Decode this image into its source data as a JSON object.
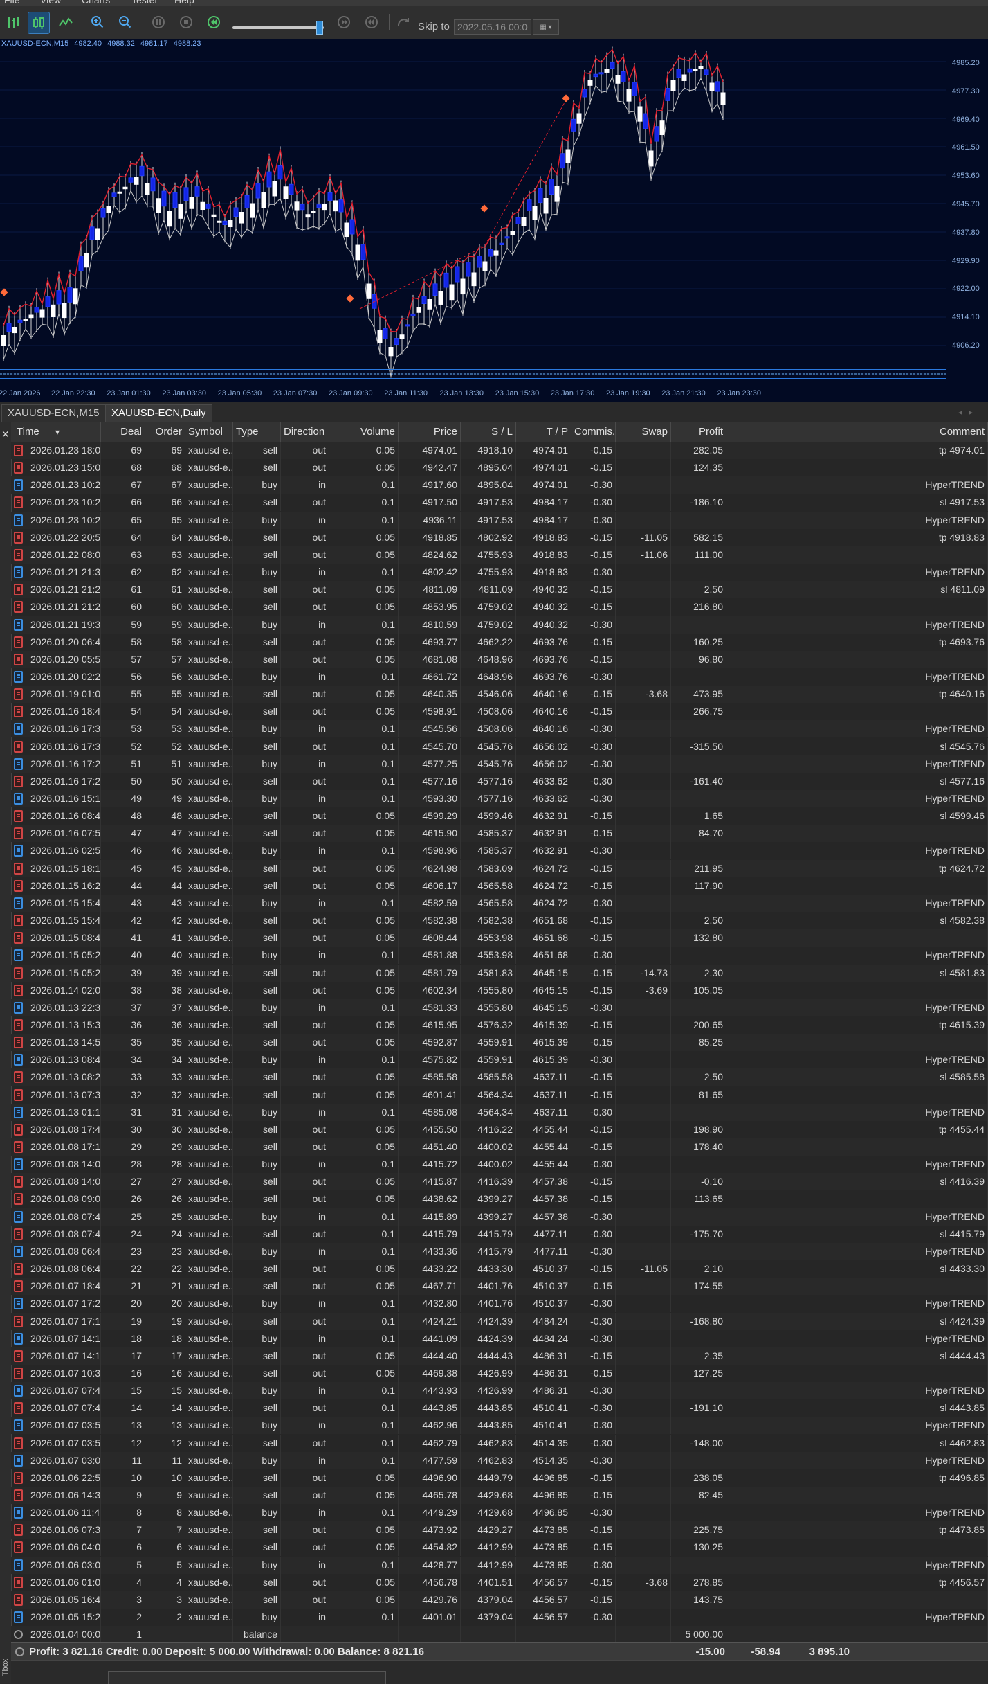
{
  "menu": [
    "File",
    "View",
    "Charts",
    "Tester",
    "Help"
  ],
  "toolbar": {
    "skip_label": "Skip to",
    "skip_value": "2022.05.16 00:00",
    "speed_fraction": 0.95
  },
  "chart": {
    "symbol_info": "XAUUSD-ECN,M15",
    "ohlc": [
      "4982.40",
      "4988.32",
      "4981.17",
      "4988.23"
    ],
    "price_ticks": [
      "4985.20",
      "4977.30",
      "4969.40",
      "4961.50",
      "4953.60",
      "4945.70",
      "4937.80",
      "4929.90",
      "4922.00",
      "4914.10",
      "4906.20"
    ],
    "time_ticks": [
      "22 Jan 2026",
      "22 Jan 22:30",
      "23 Jan 01:30",
      "23 Jan 03:30",
      "23 Jan 05:30",
      "23 Jan 07:30",
      "23 Jan 09:30",
      "23 Jan 11:30",
      "23 Jan 13:30",
      "23 Jan 15:30",
      "23 Jan 17:30",
      "23 Jan 19:30",
      "23 Jan 21:30",
      "23 Jan 23:30"
    ]
  },
  "chart_tabs": [
    "XAUUSD-ECN,M15",
    "XAUUSD-ECN,Daily"
  ],
  "table": {
    "columns": [
      "Time",
      "Deal",
      "Order",
      "Symbol",
      "Type",
      "Direction",
      "Volume",
      "Price",
      "S / L",
      "T / P",
      "Commis...",
      "Swap",
      "Profit",
      "Comment"
    ],
    "rows": [
      [
        "2026.01.23 18:0...",
        "69",
        "69",
        "xauusd-e...",
        "sell",
        "out",
        "0.05",
        "4974.01",
        "4918.10",
        "4974.01",
        "-0.15",
        "",
        "282.05",
        "tp 4974.01"
      ],
      [
        "2026.01.23 15:0...",
        "68",
        "68",
        "xauusd-e...",
        "sell",
        "out",
        "0.05",
        "4942.47",
        "4895.04",
        "4974.01",
        "-0.15",
        "",
        "124.35",
        ""
      ],
      [
        "2026.01.23 10:2...",
        "67",
        "67",
        "xauusd-e...",
        "buy",
        "in",
        "0.1",
        "4917.60",
        "4895.04",
        "4974.01",
        "-0.30",
        "",
        "",
        "HyperTREND"
      ],
      [
        "2026.01.23 10:2...",
        "66",
        "66",
        "xauusd-e...",
        "sell",
        "out",
        "0.1",
        "4917.50",
        "4917.53",
        "4984.17",
        "-0.30",
        "",
        "-186.10",
        "sl 4917.53"
      ],
      [
        "2026.01.23 10:2...",
        "65",
        "65",
        "xauusd-e...",
        "buy",
        "in",
        "0.1",
        "4936.11",
        "4917.53",
        "4984.17",
        "-0.30",
        "",
        "",
        "HyperTREND"
      ],
      [
        "2026.01.22 20:5...",
        "64",
        "64",
        "xauusd-e...",
        "sell",
        "out",
        "0.05",
        "4918.85",
        "4802.92",
        "4918.83",
        "-0.15",
        "-11.05",
        "582.15",
        "tp 4918.83"
      ],
      [
        "2026.01.22 08:0...",
        "63",
        "63",
        "xauusd-e...",
        "sell",
        "out",
        "0.05",
        "4824.62",
        "4755.93",
        "4918.83",
        "-0.15",
        "-11.06",
        "111.00",
        ""
      ],
      [
        "2026.01.21 21:3...",
        "62",
        "62",
        "xauusd-e...",
        "buy",
        "in",
        "0.1",
        "4802.42",
        "4755.93",
        "4918.83",
        "-0.30",
        "",
        "",
        "HyperTREND"
      ],
      [
        "2026.01.21 21:2...",
        "61",
        "61",
        "xauusd-e...",
        "sell",
        "out",
        "0.05",
        "4811.09",
        "4811.09",
        "4940.32",
        "-0.15",
        "",
        "2.50",
        "sl 4811.09"
      ],
      [
        "2026.01.21 21:2...",
        "60",
        "60",
        "xauusd-e...",
        "sell",
        "out",
        "0.05",
        "4853.95",
        "4759.02",
        "4940.32",
        "-0.15",
        "",
        "216.80",
        ""
      ],
      [
        "2026.01.21 19:3...",
        "59",
        "59",
        "xauusd-e...",
        "buy",
        "in",
        "0.1",
        "4810.59",
        "4759.02",
        "4940.32",
        "-0.30",
        "",
        "",
        "HyperTREND"
      ],
      [
        "2026.01.20 06:4...",
        "58",
        "58",
        "xauusd-e...",
        "sell",
        "out",
        "0.05",
        "4693.77",
        "4662.22",
        "4693.76",
        "-0.15",
        "",
        "160.25",
        "tp 4693.76"
      ],
      [
        "2026.01.20 05:5...",
        "57",
        "57",
        "xauusd-e...",
        "sell",
        "out",
        "0.05",
        "4681.08",
        "4648.96",
        "4693.76",
        "-0.15",
        "",
        "96.80",
        ""
      ],
      [
        "2026.01.20 02:2...",
        "56",
        "56",
        "xauusd-e...",
        "buy",
        "in",
        "0.1",
        "4661.72",
        "4648.96",
        "4693.76",
        "-0.30",
        "",
        "",
        "HyperTREND"
      ],
      [
        "2026.01.19 01:0...",
        "55",
        "55",
        "xauusd-e...",
        "sell",
        "out",
        "0.05",
        "4640.35",
        "4546.06",
        "4640.16",
        "-0.15",
        "-3.68",
        "473.95",
        "tp 4640.16"
      ],
      [
        "2026.01.16 18:4...",
        "54",
        "54",
        "xauusd-e...",
        "sell",
        "out",
        "0.05",
        "4598.91",
        "4508.06",
        "4640.16",
        "-0.15",
        "",
        "266.75",
        ""
      ],
      [
        "2026.01.16 17:3...",
        "53",
        "53",
        "xauusd-e...",
        "buy",
        "in",
        "0.1",
        "4545.56",
        "4508.06",
        "4640.16",
        "-0.30",
        "",
        "",
        "HyperTREND"
      ],
      [
        "2026.01.16 17:3...",
        "52",
        "52",
        "xauusd-e...",
        "sell",
        "out",
        "0.1",
        "4545.70",
        "4545.76",
        "4656.02",
        "-0.30",
        "",
        "-315.50",
        "sl 4545.76"
      ],
      [
        "2026.01.16 17:2...",
        "51",
        "51",
        "xauusd-e...",
        "buy",
        "in",
        "0.1",
        "4577.25",
        "4545.76",
        "4656.02",
        "-0.30",
        "",
        "",
        "HyperTREND"
      ],
      [
        "2026.01.16 17:2...",
        "50",
        "50",
        "xauusd-e...",
        "sell",
        "out",
        "0.1",
        "4577.16",
        "4577.16",
        "4633.62",
        "-0.30",
        "",
        "-161.40",
        "sl 4577.16"
      ],
      [
        "2026.01.16 15:1...",
        "49",
        "49",
        "xauusd-e...",
        "buy",
        "in",
        "0.1",
        "4593.30",
        "4577.16",
        "4633.62",
        "-0.30",
        "",
        "",
        "HyperTREND"
      ],
      [
        "2026.01.16 08:4...",
        "48",
        "48",
        "xauusd-e...",
        "sell",
        "out",
        "0.05",
        "4599.29",
        "4599.46",
        "4632.91",
        "-0.15",
        "",
        "1.65",
        "sl 4599.46"
      ],
      [
        "2026.01.16 07:5...",
        "47",
        "47",
        "xauusd-e...",
        "sell",
        "out",
        "0.05",
        "4615.90",
        "4585.37",
        "4632.91",
        "-0.15",
        "",
        "84.70",
        ""
      ],
      [
        "2026.01.16 02:5...",
        "46",
        "46",
        "xauusd-e...",
        "buy",
        "in",
        "0.1",
        "4598.96",
        "4585.37",
        "4632.91",
        "-0.30",
        "",
        "",
        "HyperTREND"
      ],
      [
        "2026.01.15 18:1...",
        "45",
        "45",
        "xauusd-e...",
        "sell",
        "out",
        "0.05",
        "4624.98",
        "4583.09",
        "4624.72",
        "-0.15",
        "",
        "211.95",
        "tp 4624.72"
      ],
      [
        "2026.01.15 16:2...",
        "44",
        "44",
        "xauusd-e...",
        "sell",
        "out",
        "0.05",
        "4606.17",
        "4565.58",
        "4624.72",
        "-0.15",
        "",
        "117.90",
        ""
      ],
      [
        "2026.01.15 15:4...",
        "43",
        "43",
        "xauusd-e...",
        "buy",
        "in",
        "0.1",
        "4582.59",
        "4565.58",
        "4624.72",
        "-0.30",
        "",
        "",
        "HyperTREND"
      ],
      [
        "2026.01.15 15:4...",
        "42",
        "42",
        "xauusd-e...",
        "sell",
        "out",
        "0.05",
        "4582.38",
        "4582.38",
        "4651.68",
        "-0.15",
        "",
        "2.50",
        "sl 4582.38"
      ],
      [
        "2026.01.15 08:4...",
        "41",
        "41",
        "xauusd-e...",
        "sell",
        "out",
        "0.05",
        "4608.44",
        "4553.98",
        "4651.68",
        "-0.15",
        "",
        "132.80",
        ""
      ],
      [
        "2026.01.15 05:2...",
        "40",
        "40",
        "xauusd-e...",
        "buy",
        "in",
        "0.1",
        "4581.88",
        "4553.98",
        "4651.68",
        "-0.30",
        "",
        "",
        "HyperTREND"
      ],
      [
        "2026.01.15 05:2...",
        "39",
        "39",
        "xauusd-e...",
        "sell",
        "out",
        "0.05",
        "4581.79",
        "4581.83",
        "4645.15",
        "-0.15",
        "-14.73",
        "2.30",
        "sl 4581.83"
      ],
      [
        "2026.01.14 02:0...",
        "38",
        "38",
        "xauusd-e...",
        "sell",
        "out",
        "0.05",
        "4602.34",
        "4555.80",
        "4645.15",
        "-0.15",
        "-3.69",
        "105.05",
        ""
      ],
      [
        "2026.01.13 22:3...",
        "37",
        "37",
        "xauusd-e...",
        "buy",
        "in",
        "0.1",
        "4581.33",
        "4555.80",
        "4645.15",
        "-0.30",
        "",
        "",
        "HyperTREND"
      ],
      [
        "2026.01.13 15:3...",
        "36",
        "36",
        "xauusd-e...",
        "sell",
        "out",
        "0.05",
        "4615.95",
        "4576.32",
        "4615.39",
        "-0.15",
        "",
        "200.65",
        "tp 4615.39"
      ],
      [
        "2026.01.13 14:5...",
        "35",
        "35",
        "xauusd-e...",
        "sell",
        "out",
        "0.05",
        "4592.87",
        "4559.91",
        "4615.39",
        "-0.15",
        "",
        "85.25",
        ""
      ],
      [
        "2026.01.13 08:4...",
        "34",
        "34",
        "xauusd-e...",
        "buy",
        "in",
        "0.1",
        "4575.82",
        "4559.91",
        "4615.39",
        "-0.30",
        "",
        "",
        "HyperTREND"
      ],
      [
        "2026.01.13 08:2...",
        "33",
        "33",
        "xauusd-e...",
        "sell",
        "out",
        "0.05",
        "4585.58",
        "4585.58",
        "4637.11",
        "-0.15",
        "",
        "2.50",
        "sl 4585.58"
      ],
      [
        "2026.01.13 07:3...",
        "32",
        "32",
        "xauusd-e...",
        "sell",
        "out",
        "0.05",
        "4601.41",
        "4564.34",
        "4637.11",
        "-0.15",
        "",
        "81.65",
        ""
      ],
      [
        "2026.01.13 01:1...",
        "31",
        "31",
        "xauusd-e...",
        "buy",
        "in",
        "0.1",
        "4585.08",
        "4564.34",
        "4637.11",
        "-0.30",
        "",
        "",
        "HyperTREND"
      ],
      [
        "2026.01.08 17:4...",
        "30",
        "30",
        "xauusd-e...",
        "sell",
        "out",
        "0.05",
        "4455.50",
        "4416.22",
        "4455.44",
        "-0.15",
        "",
        "198.90",
        "tp 4455.44"
      ],
      [
        "2026.01.08 17:1...",
        "29",
        "29",
        "xauusd-e...",
        "sell",
        "out",
        "0.05",
        "4451.40",
        "4400.02",
        "4455.44",
        "-0.15",
        "",
        "178.40",
        ""
      ],
      [
        "2026.01.08 14:0...",
        "28",
        "28",
        "xauusd-e...",
        "buy",
        "in",
        "0.1",
        "4415.72",
        "4400.02",
        "4455.44",
        "-0.30",
        "",
        "",
        "HyperTREND"
      ],
      [
        "2026.01.08 14:0...",
        "27",
        "27",
        "xauusd-e...",
        "sell",
        "out",
        "0.05",
        "4415.87",
        "4416.39",
        "4457.38",
        "-0.15",
        "",
        "-0.10",
        "sl 4416.39"
      ],
      [
        "2026.01.08 09:0...",
        "26",
        "26",
        "xauusd-e...",
        "sell",
        "out",
        "0.05",
        "4438.62",
        "4399.27",
        "4457.38",
        "-0.15",
        "",
        "113.65",
        ""
      ],
      [
        "2026.01.08 07:4...",
        "25",
        "25",
        "xauusd-e...",
        "buy",
        "in",
        "0.1",
        "4415.89",
        "4399.27",
        "4457.38",
        "-0.30",
        "",
        "",
        "HyperTREND"
      ],
      [
        "2026.01.08 07:4...",
        "24",
        "24",
        "xauusd-e...",
        "sell",
        "out",
        "0.1",
        "4415.79",
        "4415.79",
        "4477.11",
        "-0.30",
        "",
        "-175.70",
        "sl 4415.79"
      ],
      [
        "2026.01.08 06:4...",
        "23",
        "23",
        "xauusd-e...",
        "buy",
        "in",
        "0.1",
        "4433.36",
        "4415.79",
        "4477.11",
        "-0.30",
        "",
        "",
        "HyperTREND"
      ],
      [
        "2026.01.08 06:4...",
        "22",
        "22",
        "xauusd-e...",
        "sell",
        "out",
        "0.05",
        "4433.22",
        "4433.30",
        "4510.37",
        "-0.15",
        "-11.05",
        "2.10",
        "sl 4433.30"
      ],
      [
        "2026.01.07 18:4...",
        "21",
        "21",
        "xauusd-e...",
        "sell",
        "out",
        "0.05",
        "4467.71",
        "4401.76",
        "4510.37",
        "-0.15",
        "",
        "174.55",
        ""
      ],
      [
        "2026.01.07 17:2...",
        "20",
        "20",
        "xauusd-e...",
        "buy",
        "in",
        "0.1",
        "4432.80",
        "4401.76",
        "4510.37",
        "-0.30",
        "",
        "",
        "HyperTREND"
      ],
      [
        "2026.01.07 17:1...",
        "19",
        "19",
        "xauusd-e...",
        "sell",
        "out",
        "0.1",
        "4424.21",
        "4424.39",
        "4484.24",
        "-0.30",
        "",
        "-168.80",
        "sl 4424.39"
      ],
      [
        "2026.01.07 14:1...",
        "18",
        "18",
        "xauusd-e...",
        "buy",
        "in",
        "0.1",
        "4441.09",
        "4424.39",
        "4484.24",
        "-0.30",
        "",
        "",
        "HyperTREND"
      ],
      [
        "2026.01.07 14:1...",
        "17",
        "17",
        "xauusd-e...",
        "sell",
        "out",
        "0.05",
        "4444.40",
        "4444.43",
        "4486.31",
        "-0.15",
        "",
        "2.35",
        "sl 4444.43"
      ],
      [
        "2026.01.07 10:3...",
        "16",
        "16",
        "xauusd-e...",
        "sell",
        "out",
        "0.05",
        "4469.38",
        "4426.99",
        "4486.31",
        "-0.15",
        "",
        "127.25",
        ""
      ],
      [
        "2026.01.07 07:4...",
        "15",
        "15",
        "xauusd-e...",
        "buy",
        "in",
        "0.1",
        "4443.93",
        "4426.99",
        "4486.31",
        "-0.30",
        "",
        "",
        "HyperTREND"
      ],
      [
        "2026.01.07 07:4...",
        "14",
        "14",
        "xauusd-e...",
        "sell",
        "out",
        "0.1",
        "4443.85",
        "4443.85",
        "4510.41",
        "-0.30",
        "",
        "-191.10",
        "sl 4443.85"
      ],
      [
        "2026.01.07 03:5...",
        "13",
        "13",
        "xauusd-e...",
        "buy",
        "in",
        "0.1",
        "4462.96",
        "4443.85",
        "4510.41",
        "-0.30",
        "",
        "",
        "HyperTREND"
      ],
      [
        "2026.01.07 03:5...",
        "12",
        "12",
        "xauusd-e...",
        "sell",
        "out",
        "0.1",
        "4462.79",
        "4462.83",
        "4514.35",
        "-0.30",
        "",
        "-148.00",
        "sl 4462.83"
      ],
      [
        "2026.01.07 03:0...",
        "11",
        "11",
        "xauusd-e...",
        "buy",
        "in",
        "0.1",
        "4477.59",
        "4462.83",
        "4514.35",
        "-0.30",
        "",
        "",
        "HyperTREND"
      ],
      [
        "2026.01.06 22:5...",
        "10",
        "10",
        "xauusd-e...",
        "sell",
        "out",
        "0.05",
        "4496.90",
        "4449.79",
        "4496.85",
        "-0.15",
        "",
        "238.05",
        "tp 4496.85"
      ],
      [
        "2026.01.06 14:3...",
        "9",
        "9",
        "xauusd-e...",
        "sell",
        "out",
        "0.05",
        "4465.78",
        "4429.68",
        "4496.85",
        "-0.15",
        "",
        "82.45",
        ""
      ],
      [
        "2026.01.06 11:4...",
        "8",
        "8",
        "xauusd-e...",
        "buy",
        "in",
        "0.1",
        "4449.29",
        "4429.68",
        "4496.85",
        "-0.30",
        "",
        "",
        "HyperTREND"
      ],
      [
        "2026.01.06 07:3...",
        "7",
        "7",
        "xauusd-e...",
        "sell",
        "out",
        "0.05",
        "4473.92",
        "4429.27",
        "4473.85",
        "-0.15",
        "",
        "225.75",
        "tp 4473.85"
      ],
      [
        "2026.01.06 04:0...",
        "6",
        "6",
        "xauusd-e...",
        "sell",
        "out",
        "0.05",
        "4454.82",
        "4412.99",
        "4473.85",
        "-0.15",
        "",
        "130.25",
        ""
      ],
      [
        "2026.01.06 03:0...",
        "5",
        "5",
        "xauusd-e...",
        "buy",
        "in",
        "0.1",
        "4428.77",
        "4412.99",
        "4473.85",
        "-0.30",
        "",
        "",
        "HyperTREND"
      ],
      [
        "2026.01.06 01:0...",
        "4",
        "4",
        "xauusd-e...",
        "sell",
        "out",
        "0.05",
        "4456.78",
        "4401.51",
        "4456.57",
        "-0.15",
        "-3.68",
        "278.85",
        "tp 4456.57"
      ],
      [
        "2026.01.05 16:4...",
        "3",
        "3",
        "xauusd-e...",
        "sell",
        "out",
        "0.05",
        "4429.76",
        "4379.04",
        "4456.57",
        "-0.15",
        "",
        "143.75",
        ""
      ],
      [
        "2026.01.05 15:2...",
        "2",
        "2",
        "xauusd-e...",
        "buy",
        "in",
        "0.1",
        "4401.01",
        "4379.04",
        "4456.57",
        "-0.30",
        "",
        "",
        "HyperTREND"
      ],
      [
        "2026.01.04 00:0...",
        "1",
        "",
        "",
        "balance",
        "",
        "",
        "",
        "",
        "",
        "",
        "",
        "5 000.00",
        ""
      ]
    ]
  },
  "summary": {
    "text": "Profit: 3 821.16  Credit: 0.00  Deposit: 5 000.00  Withdrawal: 0.00  Balance: 8 821.16",
    "commission": "-15.00",
    "swap": "-58.94",
    "profit": "3 895.10"
  },
  "side_label": "Tbox"
}
